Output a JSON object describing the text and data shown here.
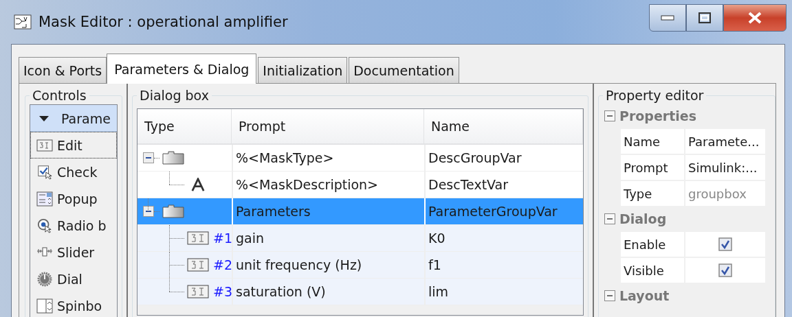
{
  "window": {
    "title": "Mask Editor : operational amplifier"
  },
  "tabs": [
    {
      "label": "Icon & Ports",
      "selected": false
    },
    {
      "label": "Parameters & Dialog",
      "selected": true
    },
    {
      "label": "Initialization",
      "selected": false
    },
    {
      "label": "Documentation",
      "selected": false
    }
  ],
  "controls": {
    "title": "Controls",
    "items": [
      {
        "label": "Parame",
        "kind": "group",
        "selected": false
      },
      {
        "label": "Edit",
        "kind": "edit",
        "selected": true
      },
      {
        "label": "Check",
        "kind": "check",
        "selected": false
      },
      {
        "label": "Popup",
        "kind": "popup",
        "selected": false
      },
      {
        "label": "Radio b",
        "kind": "radio",
        "selected": false
      },
      {
        "label": "Slider",
        "kind": "slider",
        "selected": false
      },
      {
        "label": "Dial",
        "kind": "dial",
        "selected": false
      },
      {
        "label": "Spinbo",
        "kind": "spinbox",
        "selected": false
      }
    ]
  },
  "dialog_box": {
    "title": "Dialog box",
    "columns": [
      "Type",
      "Prompt",
      "Name"
    ],
    "rows": [
      {
        "kind": "group",
        "prompt": "%<MaskType>",
        "name": "DescGroupVar",
        "selected": false,
        "expanded": true,
        "children": [
          {
            "kind": "text",
            "prompt": "%<MaskDescription>",
            "name": "DescTextVar",
            "selected": false
          }
        ]
      },
      {
        "kind": "group",
        "prompt": "Parameters",
        "name": "ParameterGroupVar",
        "selected": true,
        "expanded": true,
        "children": [
          {
            "kind": "edit",
            "index": "#1",
            "prompt": "gain",
            "name": "K0",
            "selected": false
          },
          {
            "kind": "edit",
            "index": "#2",
            "prompt": "unit frequency (Hz)",
            "name": "f1",
            "selected": false
          },
          {
            "kind": "edit",
            "index": "#3",
            "prompt": "saturation (V)",
            "name": "lim",
            "selected": false
          }
        ]
      }
    ]
  },
  "property_editor": {
    "title": "Property editor",
    "sections": [
      {
        "title": "Properties",
        "expanded": true,
        "rows": [
          {
            "label": "Name",
            "kind": "text",
            "value": "Paramete...",
            "disabled": false
          },
          {
            "label": "Prompt",
            "kind": "text",
            "value": "Simulink:...",
            "disabled": false
          },
          {
            "label": "Type",
            "kind": "text",
            "value": "groupbox",
            "disabled": true
          }
        ]
      },
      {
        "title": "Dialog",
        "expanded": true,
        "rows": [
          {
            "label": "Enable",
            "kind": "checkbox",
            "checked": true
          },
          {
            "label": "Visible",
            "kind": "checkbox",
            "checked": true
          }
        ]
      },
      {
        "title": "Layout",
        "expanded": true
      }
    ]
  }
}
